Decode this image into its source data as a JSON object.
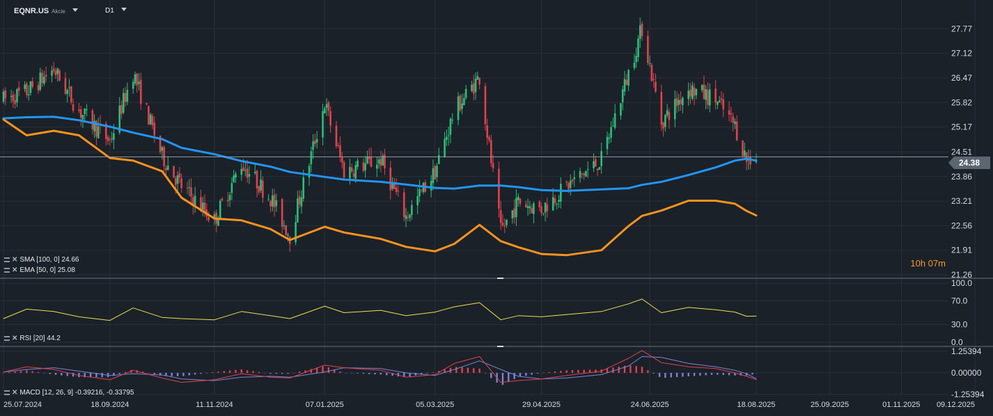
{
  "header": {
    "symbol": "EQNR.US",
    "symbol_sub": "Akcie",
    "timeframe": "D1"
  },
  "legends": {
    "sma": "SMA [100, 0] 24.66",
    "ema": "EMA [50, 0] 25.08",
    "rsi": "RSI [20] 44.2",
    "macd": "MACD [12, 26, 9] -0.39216, -0.33795"
  },
  "countdown": "10h 07m",
  "current_price": "24.38",
  "colors": {
    "background": "#1b2129",
    "bull": "#2bbf7a",
    "bear": "#e0424d",
    "sma": "#2196f3",
    "ema": "#f7931e",
    "rsi": "#e8e34e",
    "macd_line": "#e0424d",
    "signal_line": "#7b84d6",
    "macd_hist_pos": "#e0424d",
    "macd_hist_neg": "#7b84d6",
    "grid": "#28303a",
    "axis_text": "#d7dce2"
  },
  "chart_data": [
    {
      "type": "candlestick",
      "title": "EQNR.US",
      "ylim": [
        21.26,
        28.2
      ],
      "y_ticks": [
        "27.77",
        "27.12",
        "26.47",
        "25.82",
        "25.17",
        "24.51",
        "23.86",
        "23.21",
        "22.56",
        "21.91",
        "21.26"
      ],
      "x_ticks": [
        "25.07.2024",
        "18.09.2024",
        "11.11.2024",
        "07.01.2025",
        "05.03.2025",
        "29.04.2025",
        "24.06.2025",
        "18.08.2025",
        "25.09.2025",
        "01.11.2025",
        "09.12.2025"
      ],
      "price_path": [
        [
          "25.07.2024",
          25.9
        ],
        [
          "06.08.2024",
          26.1
        ],
        [
          "20.08.2024",
          26.7
        ],
        [
          "02.09.2024",
          25.6
        ],
        [
          "18.09.2024",
          24.8
        ],
        [
          "30.09.2024",
          26.6
        ],
        [
          "15.10.2024",
          24.4
        ],
        [
          "25.10.2024",
          23.6
        ],
        [
          "11.11.2024",
          22.7
        ],
        [
          "25.11.2024",
          24.2
        ],
        [
          "10.12.2024",
          23.3
        ],
        [
          "20.12.2024",
          22.3
        ],
        [
          "07.01.2025",
          25.8
        ],
        [
          "17.01.2025",
          24.0
        ],
        [
          "05.02.2025",
          24.3
        ],
        [
          "18.02.2025",
          22.8
        ],
        [
          "05.03.2025",
          24.0
        ],
        [
          "15.03.2025",
          25.6
        ],
        [
          "28.03.2025",
          26.5
        ],
        [
          "08.04.2025",
          22.4
        ],
        [
          "17.04.2025",
          23.2
        ],
        [
          "29.04.2025",
          23.0
        ],
        [
          "12.05.2025",
          23.6
        ],
        [
          "30.05.2025",
          24.3
        ],
        [
          "13.06.2025",
          26.6
        ],
        [
          "20.06.2025",
          27.8
        ],
        [
          "30.06.2025",
          25.3
        ],
        [
          "14.07.2025",
          26.2
        ],
        [
          "28.07.2025",
          25.9
        ],
        [
          "07.08.2025",
          25.2
        ],
        [
          "13.08.2025",
          24.3
        ],
        [
          "18.08.2025",
          24.38
        ]
      ],
      "series": [
        {
          "name": "SMA [100, 0]",
          "values": [
            [
              "25.07.2024",
              25.4
            ],
            [
              "06.08.2024",
              25.43
            ],
            [
              "20.08.2024",
              25.44
            ],
            [
              "02.09.2024",
              25.35
            ],
            [
              "18.09.2024",
              25.18
            ],
            [
              "30.09.2024",
              25.02
            ],
            [
              "15.10.2024",
              24.85
            ],
            [
              "25.10.2024",
              24.62
            ],
            [
              "11.11.2024",
              24.45
            ],
            [
              "25.11.2024",
              24.27
            ],
            [
              "10.12.2024",
              24.12
            ],
            [
              "20.12.2024",
              23.98
            ],
            [
              "07.01.2025",
              23.85
            ],
            [
              "17.01.2025",
              23.78
            ],
            [
              "05.02.2025",
              23.72
            ],
            [
              "18.02.2025",
              23.65
            ],
            [
              "05.03.2025",
              23.56
            ],
            [
              "15.03.2025",
              23.54
            ],
            [
              "28.03.2025",
              23.62
            ],
            [
              "08.04.2025",
              23.62
            ],
            [
              "17.04.2025",
              23.58
            ],
            [
              "29.04.2025",
              23.5
            ],
            [
              "12.05.2025",
              23.48
            ],
            [
              "30.05.2025",
              23.52
            ],
            [
              "13.06.2025",
              23.55
            ],
            [
              "20.06.2025",
              23.64
            ],
            [
              "30.06.2025",
              23.72
            ],
            [
              "14.07.2025",
              23.9
            ],
            [
              "28.07.2025",
              24.1
            ],
            [
              "07.08.2025",
              24.28
            ],
            [
              "13.08.2025",
              24.33
            ],
            [
              "18.08.2025",
              24.28
            ]
          ]
        },
        {
          "name": "EMA [50, 0]",
          "values": [
            [
              "25.07.2024",
              25.37
            ],
            [
              "06.08.2024",
              24.95
            ],
            [
              "20.08.2024",
              25.07
            ],
            [
              "02.09.2024",
              24.95
            ],
            [
              "18.09.2024",
              24.35
            ],
            [
              "30.09.2024",
              24.28
            ],
            [
              "15.10.2024",
              24.0
            ],
            [
              "25.10.2024",
              23.3
            ],
            [
              "11.11.2024",
              22.75
            ],
            [
              "25.11.2024",
              22.7
            ],
            [
              "10.12.2024",
              22.47
            ],
            [
              "20.12.2024",
              22.18
            ],
            [
              "07.01.2025",
              22.53
            ],
            [
              "17.01.2025",
              22.38
            ],
            [
              "05.02.2025",
              22.21
            ],
            [
              "18.02.2025",
              22.0
            ],
            [
              "05.03.2025",
              21.88
            ],
            [
              "15.03.2025",
              22.08
            ],
            [
              "28.03.2025",
              22.58
            ],
            [
              "08.04.2025",
              22.15
            ],
            [
              "17.04.2025",
              21.99
            ],
            [
              "29.04.2025",
              21.81
            ],
            [
              "12.05.2025",
              21.78
            ],
            [
              "30.05.2025",
              21.91
            ],
            [
              "13.06.2025",
              22.55
            ],
            [
              "20.06.2025",
              22.82
            ],
            [
              "30.06.2025",
              22.96
            ],
            [
              "14.07.2025",
              23.22
            ],
            [
              "28.07.2025",
              23.22
            ],
            [
              "07.08.2025",
              23.14
            ],
            [
              "13.08.2025",
              22.95
            ],
            [
              "18.08.2025",
              22.83
            ]
          ]
        }
      ]
    },
    {
      "type": "line",
      "title": "RSI [20]",
      "ylim": [
        0,
        100
      ],
      "y_ticks": [
        "100.0",
        "70.0",
        "30.0",
        "0.0"
      ],
      "values": [
        [
          "25.07.2024",
          40
        ],
        [
          "06.08.2024",
          56
        ],
        [
          "20.08.2024",
          52
        ],
        [
          "02.09.2024",
          43
        ],
        [
          "18.09.2024",
          37
        ],
        [
          "30.09.2024",
          58
        ],
        [
          "15.10.2024",
          42
        ],
        [
          "25.10.2024",
          40
        ],
        [
          "11.11.2024",
          38
        ],
        [
          "25.11.2024",
          52
        ],
        [
          "10.12.2024",
          45
        ],
        [
          "20.12.2024",
          40
        ],
        [
          "07.01.2025",
          61
        ],
        [
          "17.01.2025",
          50
        ],
        [
          "05.02.2025",
          54
        ],
        [
          "18.02.2025",
          45
        ],
        [
          "05.03.2025",
          51
        ],
        [
          "15.03.2025",
          60
        ],
        [
          "28.03.2025",
          67
        ],
        [
          "08.04.2025",
          38
        ],
        [
          "17.04.2025",
          45
        ],
        [
          "29.04.2025",
          43
        ],
        [
          "12.05.2025",
          47
        ],
        [
          "30.05.2025",
          52
        ],
        [
          "13.06.2025",
          65
        ],
        [
          "20.06.2025",
          73
        ],
        [
          "30.06.2025",
          50
        ],
        [
          "14.07.2025",
          59
        ],
        [
          "28.07.2025",
          55
        ],
        [
          "07.08.2025",
          51
        ],
        [
          "13.08.2025",
          44
        ],
        [
          "18.08.2025",
          44.2
        ]
      ]
    },
    {
      "type": "line+bar",
      "title": "MACD [12, 26, 9]",
      "ylim": [
        -1.25394,
        1.25394
      ],
      "y_ticks": [
        "1.25394",
        "0.00000",
        "-1.25394"
      ],
      "series": [
        {
          "name": "MACD",
          "values": [
            [
              "25.07.2024",
              0.05
            ],
            [
              "06.08.2024",
              0.35
            ],
            [
              "20.08.2024",
              0.2
            ],
            [
              "02.09.2024",
              -0.15
            ],
            [
              "18.09.2024",
              -0.4
            ],
            [
              "30.09.2024",
              0.15
            ],
            [
              "15.10.2024",
              -0.3
            ],
            [
              "25.10.2024",
              -0.55
            ],
            [
              "11.11.2024",
              -0.4
            ],
            [
              "25.11.2024",
              -0.05
            ],
            [
              "10.12.2024",
              -0.25
            ],
            [
              "20.12.2024",
              -0.3
            ],
            [
              "07.01.2025",
              0.45
            ],
            [
              "17.01.2025",
              0.3
            ],
            [
              "05.02.2025",
              0.15
            ],
            [
              "18.02.2025",
              -0.25
            ],
            [
              "05.03.2025",
              -0.1
            ],
            [
              "15.03.2025",
              0.55
            ],
            [
              "28.03.2025",
              0.95
            ],
            [
              "08.04.2025",
              -0.55
            ],
            [
              "17.04.2025",
              -0.45
            ],
            [
              "29.04.2025",
              -0.35
            ],
            [
              "12.05.2025",
              -0.15
            ],
            [
              "30.05.2025",
              0.1
            ],
            [
              "13.06.2025",
              0.85
            ],
            [
              "20.06.2025",
              1.3
            ],
            [
              "30.06.2025",
              0.6
            ],
            [
              "14.07.2025",
              0.35
            ],
            [
              "28.07.2025",
              0.25
            ],
            [
              "07.08.2025",
              0.0
            ],
            [
              "13.08.2025",
              -0.2
            ],
            [
              "18.08.2025",
              -0.39216
            ]
          ]
        },
        {
          "name": "Signal",
          "values": [
            [
              "25.07.2024",
              0.05
            ],
            [
              "06.08.2024",
              0.2
            ],
            [
              "20.08.2024",
              0.3
            ],
            [
              "02.09.2024",
              0.1
            ],
            [
              "18.09.2024",
              -0.15
            ],
            [
              "30.09.2024",
              -0.05
            ],
            [
              "15.10.2024",
              -0.12
            ],
            [
              "25.10.2024",
              -0.35
            ],
            [
              "11.11.2024",
              -0.45
            ],
            [
              "25.11.2024",
              -0.25
            ],
            [
              "10.12.2024",
              -0.2
            ],
            [
              "20.12.2024",
              -0.25
            ],
            [
              "07.01.2025",
              0.05
            ],
            [
              "17.01.2025",
              0.3
            ],
            [
              "05.02.2025",
              0.25
            ],
            [
              "18.02.2025",
              0.0
            ],
            [
              "05.03.2025",
              -0.15
            ],
            [
              "15.03.2025",
              0.2
            ],
            [
              "28.03.2025",
              0.7
            ],
            [
              "08.04.2025",
              0.2
            ],
            [
              "17.04.2025",
              -0.2
            ],
            [
              "29.04.2025",
              -0.35
            ],
            [
              "12.05.2025",
              -0.3
            ],
            [
              "30.05.2025",
              -0.1
            ],
            [
              "13.06.2025",
              0.4
            ],
            [
              "20.06.2025",
              0.95
            ],
            [
              "30.06.2025",
              0.9
            ],
            [
              "14.07.2025",
              0.55
            ],
            [
              "28.07.2025",
              0.35
            ],
            [
              "07.08.2025",
              0.15
            ],
            [
              "13.08.2025",
              -0.05
            ],
            [
              "18.08.2025",
              -0.33795
            ]
          ]
        }
      ]
    }
  ]
}
